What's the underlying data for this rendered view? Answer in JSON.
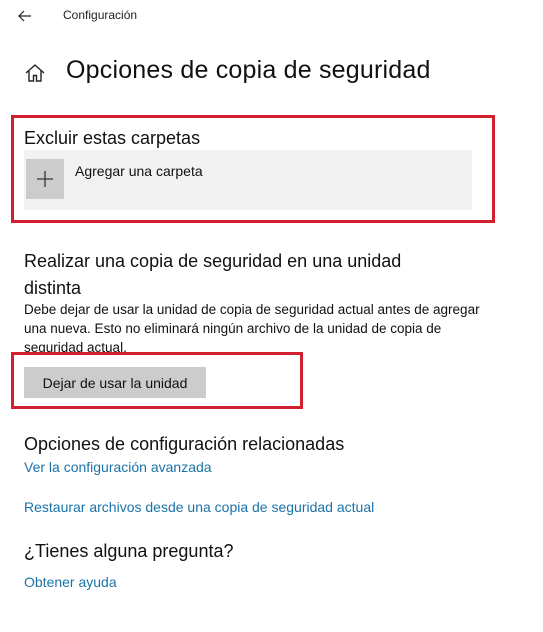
{
  "window": {
    "app_title": "Configuración",
    "back_icon": "back-arrow-icon"
  },
  "header": {
    "home_icon": "home-icon",
    "title": "Opciones de copia de seguridad"
  },
  "exclude_section": {
    "title": "Excluir estas carpetas",
    "add_icon": "plus-icon",
    "add_label": "Agregar una carpeta"
  },
  "drive_section": {
    "title": "Realizar una copia de seguridad en una unidad distinta",
    "description": "Debe dejar de usar la unidad de copia de seguridad actual antes de agregar una nueva. Esto no eliminará ningún archivo de la unidad de copia de seguridad actual.",
    "button_label": "Dejar de usar la unidad"
  },
  "related_section": {
    "title": "Opciones de configuración relacionadas",
    "links": [
      "Ver la configuración avanzada",
      "Restaurar archivos desde una copia de seguridad actual"
    ]
  },
  "help_section": {
    "title": "¿Tienes alguna pregunta?",
    "link": "Obtener ayuda"
  },
  "colors": {
    "link": "#1a73a8",
    "highlight": "#d2202f",
    "button_bg": "#cccccc",
    "tile_bg": "#f2f2f2"
  }
}
